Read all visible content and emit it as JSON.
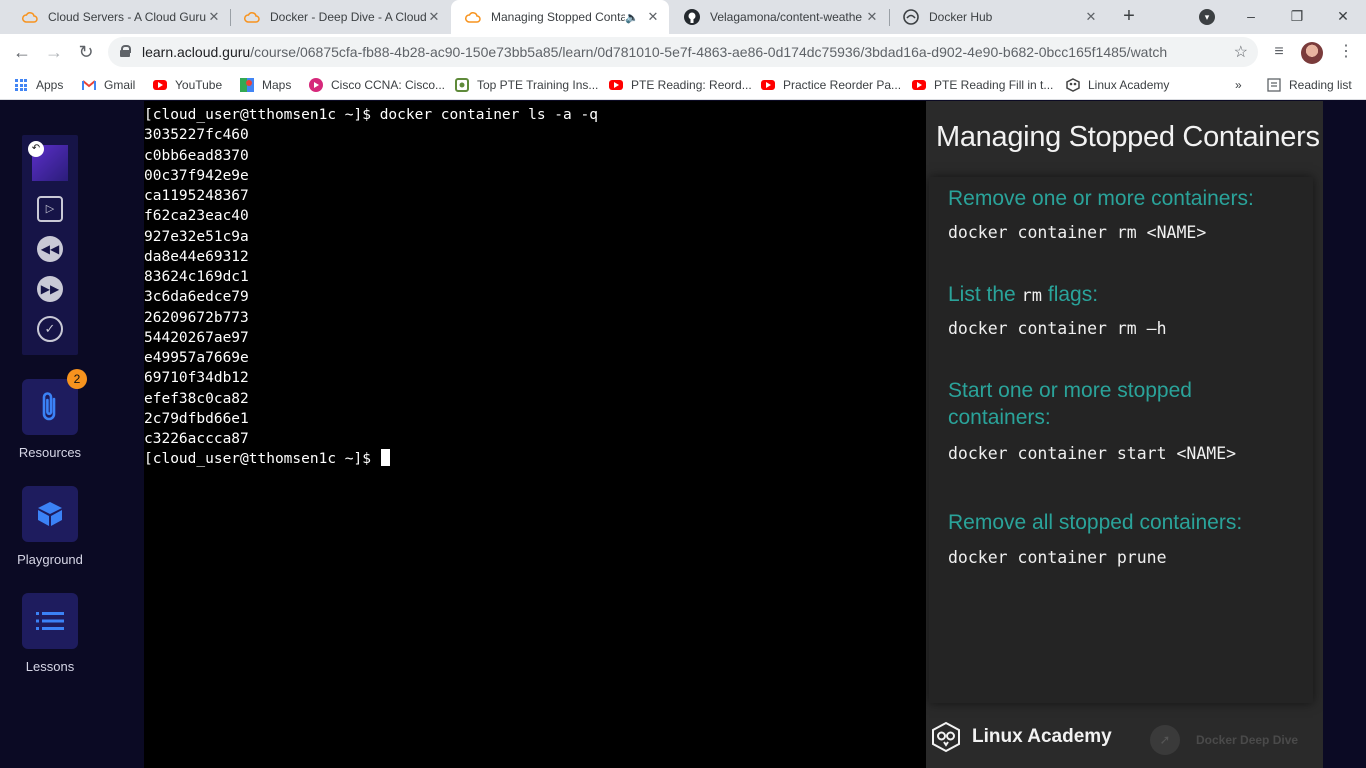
{
  "tabs": [
    {
      "title": "Cloud Servers - A Cloud Guru",
      "icon": "acg-cloud-icon"
    },
    {
      "title": "Docker - Deep Dive - A Cloud",
      "icon": "acg-cloud-icon"
    },
    {
      "title": "Managing Stopped Conta",
      "icon": "acg-cloud-icon",
      "active": true,
      "audio": true
    },
    {
      "title": "Velagamona/content-weathe",
      "icon": "github-icon"
    },
    {
      "title": "Docker Hub",
      "icon": "docker-hub-icon"
    }
  ],
  "new_tab_label": "+",
  "window_buttons": {
    "minimize": "–",
    "maximize": "❐",
    "close": "✕"
  },
  "address": {
    "host": "learn.acloud.guru",
    "path": "/course/06875cfa-fb88-4b28-ac90-150e73bb5a85/learn/0d781010-5e7f-4863-ae86-0d174dc75936/3bdad16a-d902-4e90-b682-0bcc165f1485/watch"
  },
  "bookmarks": [
    {
      "label": "Apps",
      "icon": "apps-grid-icon"
    },
    {
      "label": "Gmail",
      "icon": "gmail-icon"
    },
    {
      "label": "YouTube",
      "icon": "youtube-icon"
    },
    {
      "label": "Maps",
      "icon": "maps-icon"
    },
    {
      "label": "Cisco CCNA: Cisco...",
      "icon": "cisco-icon"
    },
    {
      "label": "Top PTE Training Ins...",
      "icon": "pte-icon"
    },
    {
      "label": "PTE Reading: Reord...",
      "icon": "youtube-icon"
    },
    {
      "label": "Practice Reorder Pa...",
      "icon": "youtube-icon"
    },
    {
      "label": "PTE Reading Fill in t...",
      "icon": "youtube-icon"
    },
    {
      "label": "Linux Academy",
      "icon": "linux-academy-icon"
    }
  ],
  "bookmarks_overflow": "»",
  "reading_list_label": "Reading list",
  "sidebar": {
    "resources_label": "Resources",
    "resources_badge": "2",
    "playground_label": "Playground",
    "lessons_label": "Lessons"
  },
  "terminal": {
    "command_line": "[cloud_user@tthomsen1c ~]$ docker container ls -a -q",
    "output": [
      "3035227fc460",
      "c0bb6ead8370",
      "00c37f942e9e",
      "ca1195248367",
      "f62ca23eac40",
      "927e32e51c9a",
      "da8e44e69312",
      "83624c169dc1",
      "3c6da6edce79",
      "26209672b773",
      "54420267ae97",
      "e49957a7669e",
      "69710f34db12",
      "efef38c0ca82",
      "2c79dfbd66e1",
      "c3226accca87"
    ],
    "prompt": "[cloud_user@tthomsen1c ~]$ "
  },
  "slide": {
    "title": "Managing Stopped Containers",
    "sections": [
      {
        "heading": "Remove one or more containers:",
        "code": "docker container rm <NAME>"
      },
      {
        "heading_pre": "List the ",
        "heading_code": "rm",
        "heading_post": " flags:",
        "code": "docker container rm –h"
      },
      {
        "heading_line1": "Start one or more stopped",
        "heading_line2": "containers:",
        "code": "docker container start <NAME>"
      },
      {
        "heading": "Remove all stopped containers:",
        "code": "docker container prune"
      }
    ],
    "brand": "Linux Academy",
    "course": "Docker Deep Dive"
  },
  "colors": {
    "accent": "#2aa39a",
    "badge": "#f7931e",
    "sidebar_bg": "#0b0a24"
  }
}
